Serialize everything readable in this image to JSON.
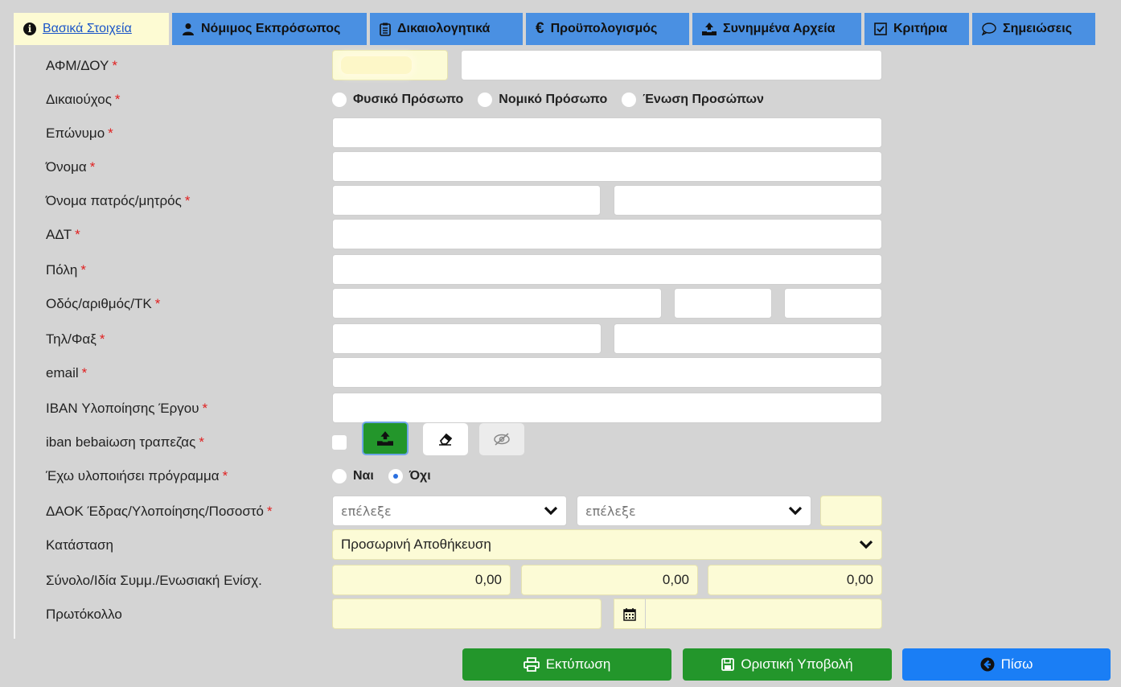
{
  "tabs": [
    {
      "label": "Βασικά Στοιχεία",
      "icon": "info-circle-icon",
      "active": true
    },
    {
      "label": "Νόμιμος Εκπρόσωπος",
      "icon": "user-icon"
    },
    {
      "label": "Δικαιολογητικά",
      "icon": "clipboard-icon"
    },
    {
      "label": "Προϋπολογισμός",
      "icon": "euro-icon"
    },
    {
      "label": "Συνημμένα Αρχεία",
      "icon": "upload-icon"
    },
    {
      "label": "Κριτήρια",
      "icon": "checkbox-icon"
    },
    {
      "label": "Σημειώσεις",
      "icon": "comment-icon"
    }
  ],
  "form": {
    "required_mark": "*",
    "afm": {
      "label": "ΑΦΜ/ΔΟΥ"
    },
    "beneficiary": {
      "label": "Δικαιούχος",
      "options": [
        "Φυσικό Πρόσωπο",
        "Νομικό Πρόσωπο",
        "Ένωση Προσώπων"
      ]
    },
    "surname": {
      "label": "Επώνυμο"
    },
    "name": {
      "label": "Όνομα"
    },
    "parent_name": {
      "label": "Όνομα πατρός/μητρός"
    },
    "adt": {
      "label": "ΑΔΤ"
    },
    "city": {
      "label": "Πόλη"
    },
    "address": {
      "label": "Οδός/αριθμός/ΤΚ"
    },
    "phone_fax": {
      "label": "Τηλ/Φαξ"
    },
    "email": {
      "label": "email"
    },
    "iban": {
      "label": "IBAN Υλοποίησης Έργου"
    },
    "iban_cert": {
      "label": "iban bebaiωση τραπεζας"
    },
    "implemented": {
      "label": "Έχω υλοποιήσει πρόγραμμα",
      "options": [
        "Ναι",
        "Όχι"
      ],
      "selected": "Όχι"
    },
    "daok": {
      "label": "ΔΑΟΚ Έδρας/Υλοποίησης/Ποσοστό",
      "select1": "επέλεξε",
      "select2": "επέλεξε"
    },
    "status": {
      "label": "Κατάσταση",
      "value": "Προσωρινή Αποθήκευση"
    },
    "totals": {
      "label": "Σύνολο/Ιδία Συμμ./Ενωσιακή Ενίσχ.",
      "total": "0,00",
      "own": "0,00",
      "eu": "0,00"
    },
    "protocol": {
      "label": "Πρωτόκολλο"
    }
  },
  "buttons": {
    "print": "Εκτύπωση",
    "submit": "Οριστική Υποβολή",
    "back": "Πίσω"
  },
  "colors": {
    "tab_blue": "#4a90e2",
    "active_tab": "#fdfbd3",
    "green": "#23962b",
    "blue": "#1a7ef5",
    "required": "#e02020"
  }
}
